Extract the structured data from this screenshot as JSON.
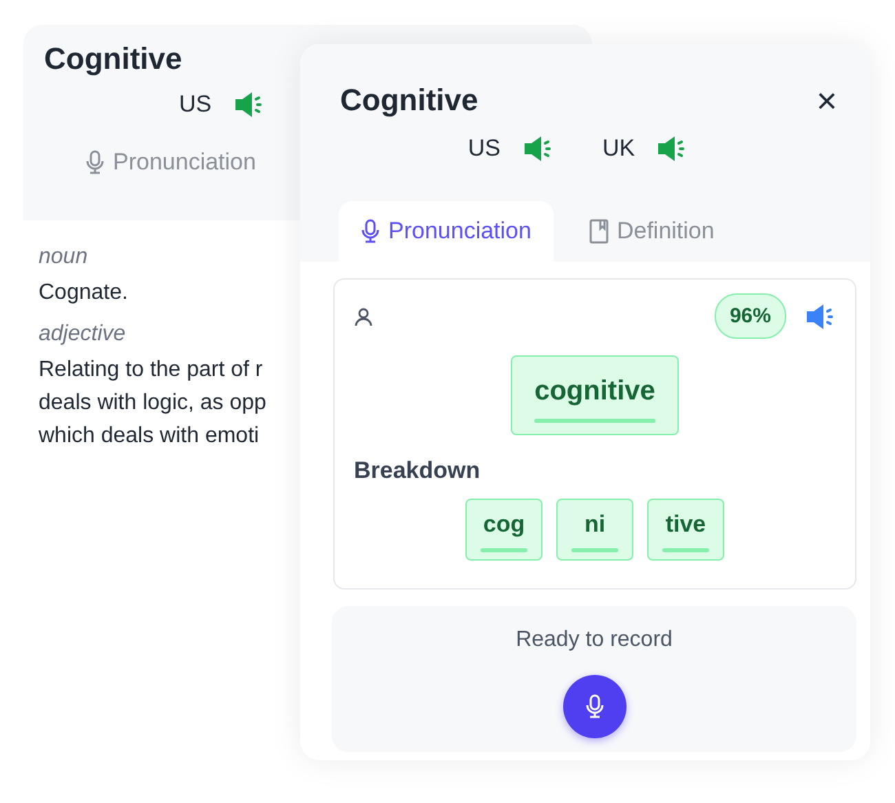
{
  "back_card": {
    "title": "Cognitive",
    "accents": [
      {
        "label": "US"
      }
    ],
    "tabs": [
      {
        "label": "Pronunciation",
        "kind": "mic",
        "selected": false
      }
    ],
    "definitions": [
      {
        "part_of_speech": "noun",
        "lines": [
          "Cognate."
        ]
      },
      {
        "part_of_speech": "adjective",
        "lines": [
          "Relating to the part of r",
          "deals with logic, as opp",
          "which deals with emoti"
        ]
      }
    ]
  },
  "front_card": {
    "title": "Cognitive",
    "close": "×",
    "accents": [
      {
        "label": "US"
      },
      {
        "label": "UK"
      }
    ],
    "tabs": [
      {
        "label": "Pronunciation",
        "kind": "mic",
        "selected": true
      },
      {
        "label": "Definition",
        "kind": "book",
        "selected": false
      }
    ],
    "score": "96%",
    "word": "cognitive",
    "breakdown_title": "Breakdown",
    "syllables": [
      "cog",
      "ni",
      "tive"
    ],
    "record_status": "Ready to record"
  }
}
